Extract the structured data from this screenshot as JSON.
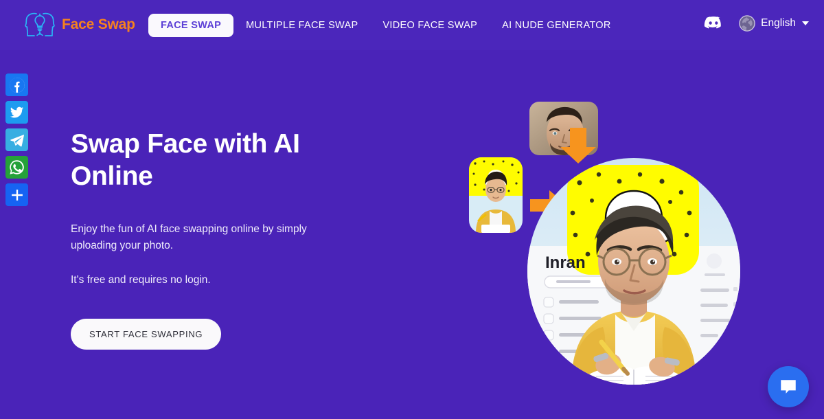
{
  "brand": {
    "name": "Face Swap",
    "logo_icon": "two-faces-lightbulb-icon",
    "logo_color": "#f5821f",
    "logo_mark_color": "#29b6f6"
  },
  "nav": {
    "items": [
      {
        "label": "FACE SWAP",
        "active": true
      },
      {
        "label": "MULTIPLE FACE SWAP",
        "active": false
      },
      {
        "label": "VIDEO FACE SWAP",
        "active": false
      },
      {
        "label": "AI NUDE GENERATOR",
        "active": false
      }
    ],
    "active_bg": "#faf9fd",
    "active_text": "#5b3fd6"
  },
  "header": {
    "discord_icon": "discord-icon",
    "globe_icon": "globe-icon",
    "language": "English",
    "caret_icon": "chevron-down-icon",
    "background": "#4b26bb"
  },
  "social_rail": {
    "items": [
      {
        "name": "facebook",
        "icon": "facebook-icon",
        "color": "#1877f2"
      },
      {
        "name": "twitter",
        "icon": "twitter-bird-icon",
        "color": "#1d9bf0"
      },
      {
        "name": "telegram",
        "icon": "telegram-icon",
        "color": "#37aee2"
      },
      {
        "name": "whatsapp",
        "icon": "whatsapp-icon",
        "color": "#25a13a"
      },
      {
        "name": "share",
        "icon": "plus-share-icon",
        "color": "#1663f3"
      }
    ]
  },
  "hero": {
    "title_line1": "Swap Face with AI",
    "title_line2": "Online",
    "paragraph": "Enjoy the fun of AI face swapping online by simply uploading your photo.",
    "paragraph2": "It's free and requires no login.",
    "cta_label": "START FACE SWAPPING",
    "background": "#4a23b8"
  },
  "hero_art": {
    "source_face_alt": "bearded-man-portrait",
    "thumbnail_alt": "young-man-yellow-cardigan-thumbnail",
    "result_alt": "young-man-yellow-cardigan-snapchat-profile",
    "profile_name": "Inran",
    "arrow_color": "#f7941e",
    "snap_yellow": "#fffc00"
  },
  "chat": {
    "icon": "chat-bubble-icon",
    "color": "#2a6ef0"
  }
}
